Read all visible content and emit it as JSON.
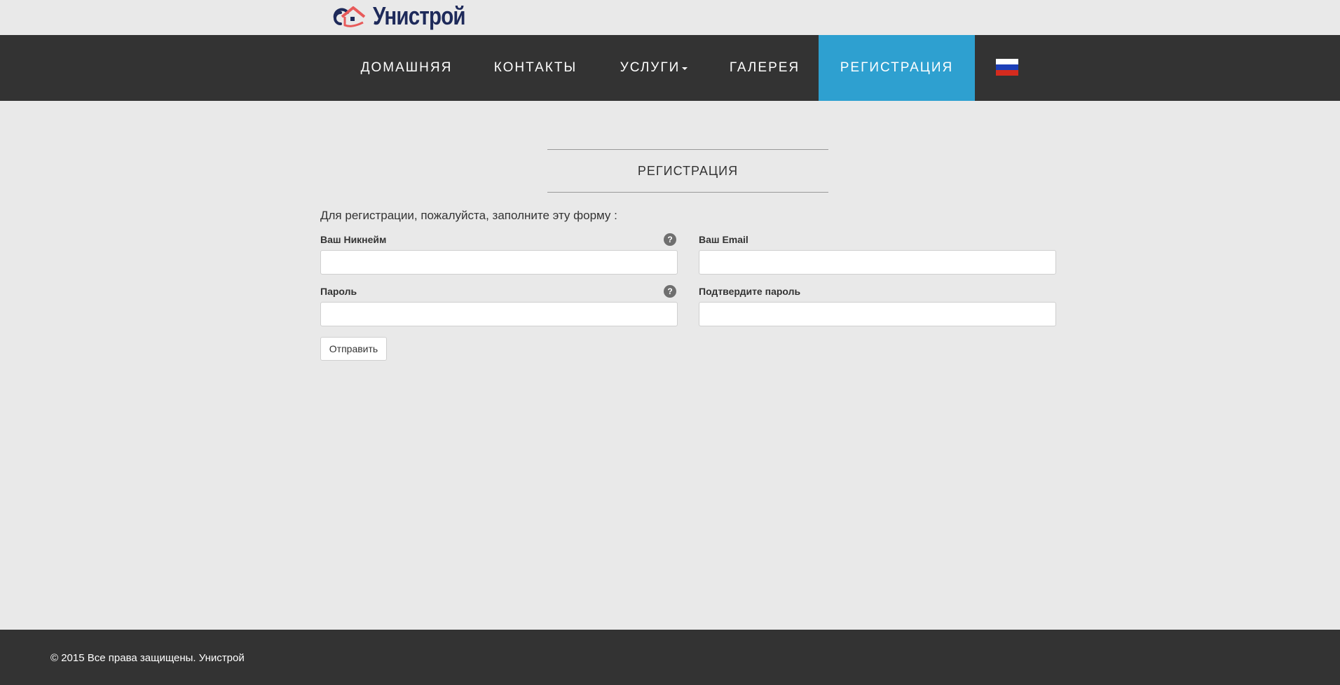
{
  "brand": {
    "name": "Унистрой"
  },
  "nav": {
    "home": "ДОМАШНЯЯ",
    "contacts": "КОНТАКТЫ",
    "services": "УСЛУГИ",
    "gallery": "ГАЛЕРЕЯ",
    "register": "РЕГИСТРАЦИЯ",
    "active_color": "#2ea0d0",
    "bar_color": "#333333",
    "language_icon": "russian-flag-icon"
  },
  "page": {
    "title": "РЕГИСТРАЦИЯ",
    "intro": "Для регистрации, пожалуйста, заполните эту форму :"
  },
  "form": {
    "nickname_label": "Ваш Никнейм",
    "email_label": "Ваш Email",
    "password_label": "Пароль",
    "confirm_label": "Подтвердите пароль",
    "help_glyph": "?",
    "nickname_value": "",
    "email_value": "",
    "password_value": "",
    "confirm_value": "",
    "submit_label": "Отправить"
  },
  "footer": {
    "text": "© 2015 Все права защищены. Унистрой"
  }
}
